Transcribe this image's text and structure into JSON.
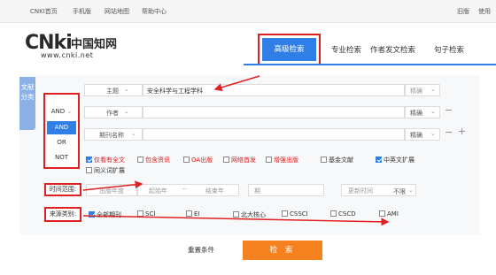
{
  "topbar": {
    "links": [
      "CNKI首页",
      "手机版",
      "网站地图",
      "帮助中心"
    ],
    "right": [
      "旧版",
      "使用"
    ]
  },
  "logo": {
    "mark": "CNki",
    "cn": "中国知网",
    "url": "www.cnki.net"
  },
  "tabs": [
    "高级检索",
    "专业检索",
    "作者发文检索",
    "句子检索"
  ],
  "side_tab": "文献分类",
  "rows": [
    {
      "field": "主题",
      "value": "安全科学与工程学科",
      "match": "精确"
    },
    {
      "field": "作者",
      "value": "",
      "match": "精确"
    },
    {
      "field": "期刊名称",
      "value": "",
      "match": "精确"
    }
  ],
  "logic": {
    "selected": "AND",
    "options": [
      "AND",
      "OR",
      "NOT"
    ]
  },
  "ops": {
    "minus": "−",
    "plus": "+"
  },
  "options": [
    {
      "label": "仅看有全文",
      "checked": true,
      "red": true
    },
    {
      "label": "包含资讯",
      "checked": false,
      "red": true
    },
    {
      "label": "OA出版",
      "checked": false,
      "red": true
    },
    {
      "label": "网络首发",
      "checked": false,
      "red": true
    },
    {
      "label": "增强出版",
      "checked": false,
      "red": true
    },
    {
      "label": "基金文献",
      "checked": false,
      "red": false
    },
    {
      "label": "中英文扩展",
      "checked": true,
      "red": false
    },
    {
      "label": "同义词扩展",
      "checked": false,
      "red": false
    }
  ],
  "time": {
    "label": "时间范围:",
    "start_ph": "出版年度",
    "start2_ph": "起始年",
    "sep": "--",
    "end_ph": "结束年",
    "period_label": "期",
    "update_label": "更新时间",
    "update_value": "不限"
  },
  "source": {
    "label": "来源类别:",
    "items": [
      {
        "label": "全部期刊",
        "checked": true
      },
      {
        "label": "SCI",
        "checked": false
      },
      {
        "label": "EI",
        "checked": false
      },
      {
        "label": "北大核心",
        "checked": false
      },
      {
        "label": "CSSCI",
        "checked": false
      },
      {
        "label": "CSCD",
        "checked": false
      },
      {
        "label": "AMI",
        "checked": false
      }
    ]
  },
  "buttons": {
    "reset": "重置条件",
    "search": "检 索"
  },
  "colors": {
    "accent": "#2f7fe6",
    "annotation": "#e02020",
    "search_button": "#f5821f"
  }
}
